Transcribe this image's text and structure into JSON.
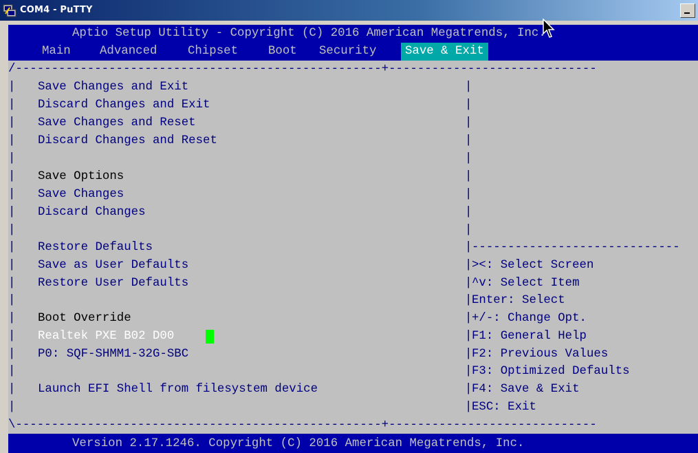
{
  "window": {
    "title": "COM4 - PuTTY",
    "app_icon": "putty-icon",
    "min_button_icon": "minimize-icon",
    "pointer_icon": "mouse-pointer-icon"
  },
  "bios": {
    "header": "Aptio Setup Utility - Copyright (C) 2016 American Megatrends, Inc.",
    "tabs": [
      "Main",
      "Advanced",
      "Chipset",
      "Boot",
      "Security",
      "Save & Exit"
    ],
    "active_tab": "Save & Exit",
    "menu_items": [
      "Save Changes and Exit",
      "Discard Changes and Exit",
      "Save Changes and Reset",
      "Discard Changes and Reset"
    ],
    "save_options_heading": "Save Options",
    "save_options_items": [
      "Save Changes",
      "Discard Changes"
    ],
    "default_items": [
      "Restore Defaults",
      "Save as User Defaults",
      "Restore User Defaults"
    ],
    "boot_override_heading": "Boot Override",
    "boot_override_items": [
      "Realtek PXE B02 D00",
      "P0: SQF-SHMM1-32G-SBC"
    ],
    "launch_efi": "Launch EFI Shell from filesystem device",
    "help": [
      "><: Select Screen",
      "^v: Select Item",
      "Enter: Select",
      "+/-: Change Opt.",
      "F1: General Help",
      "F2: Previous Values",
      "F3: Optimized Defaults",
      "F4: Save & Exit",
      "ESC: Exit"
    ],
    "footer": "Version 2.17.1246. Copyright (C) 2016 American Megatrends, Inc."
  },
  "colors": {
    "terminal_bg": "#000080",
    "header_bg": "#0000aa",
    "content_bg": "#c0c0c0",
    "active_tab_bg": "#00a8a8",
    "text_cursor": "#00ff00"
  }
}
